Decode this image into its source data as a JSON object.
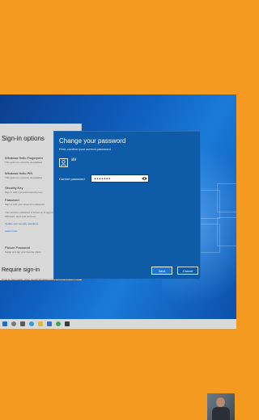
{
  "settings": {
    "title": "Sign-in options",
    "items": [
      {
        "label": "Windows Hello Fingerprint",
        "sub": "This option is currently unavailable"
      },
      {
        "label": "Windows Hello PIN",
        "sub": "This option is currently unavailable"
      },
      {
        "label": "Security Key",
        "sub": "Sign in with a physical security key"
      },
      {
        "label": "Password",
        "sub": "Sign in with your account's password"
      }
    ],
    "notice": "Your account password is all set up to sign in to",
    "notice2": "Windows, apps and services.",
    "link1": "Update your security questions",
    "link2": "Learn more",
    "picture_password": "Picture Password",
    "picture_password_sub": "Swipe and tap your favorite photo",
    "require_signin": "Require sign-in",
    "require_sub": "If you've been away, when should Windows require you to sign in again?"
  },
  "dialog": {
    "title": "Change your password",
    "subtitle": "First, confirm your current password",
    "username": "av",
    "password_label": "Current password",
    "password_value": "•••••••",
    "next_label": "Next",
    "cancel_label": "Cancel"
  },
  "taskbar": {
    "icons": [
      "windows-start",
      "search",
      "task-view",
      "edge",
      "file-explorer",
      "store",
      "chrome",
      "settings"
    ]
  }
}
